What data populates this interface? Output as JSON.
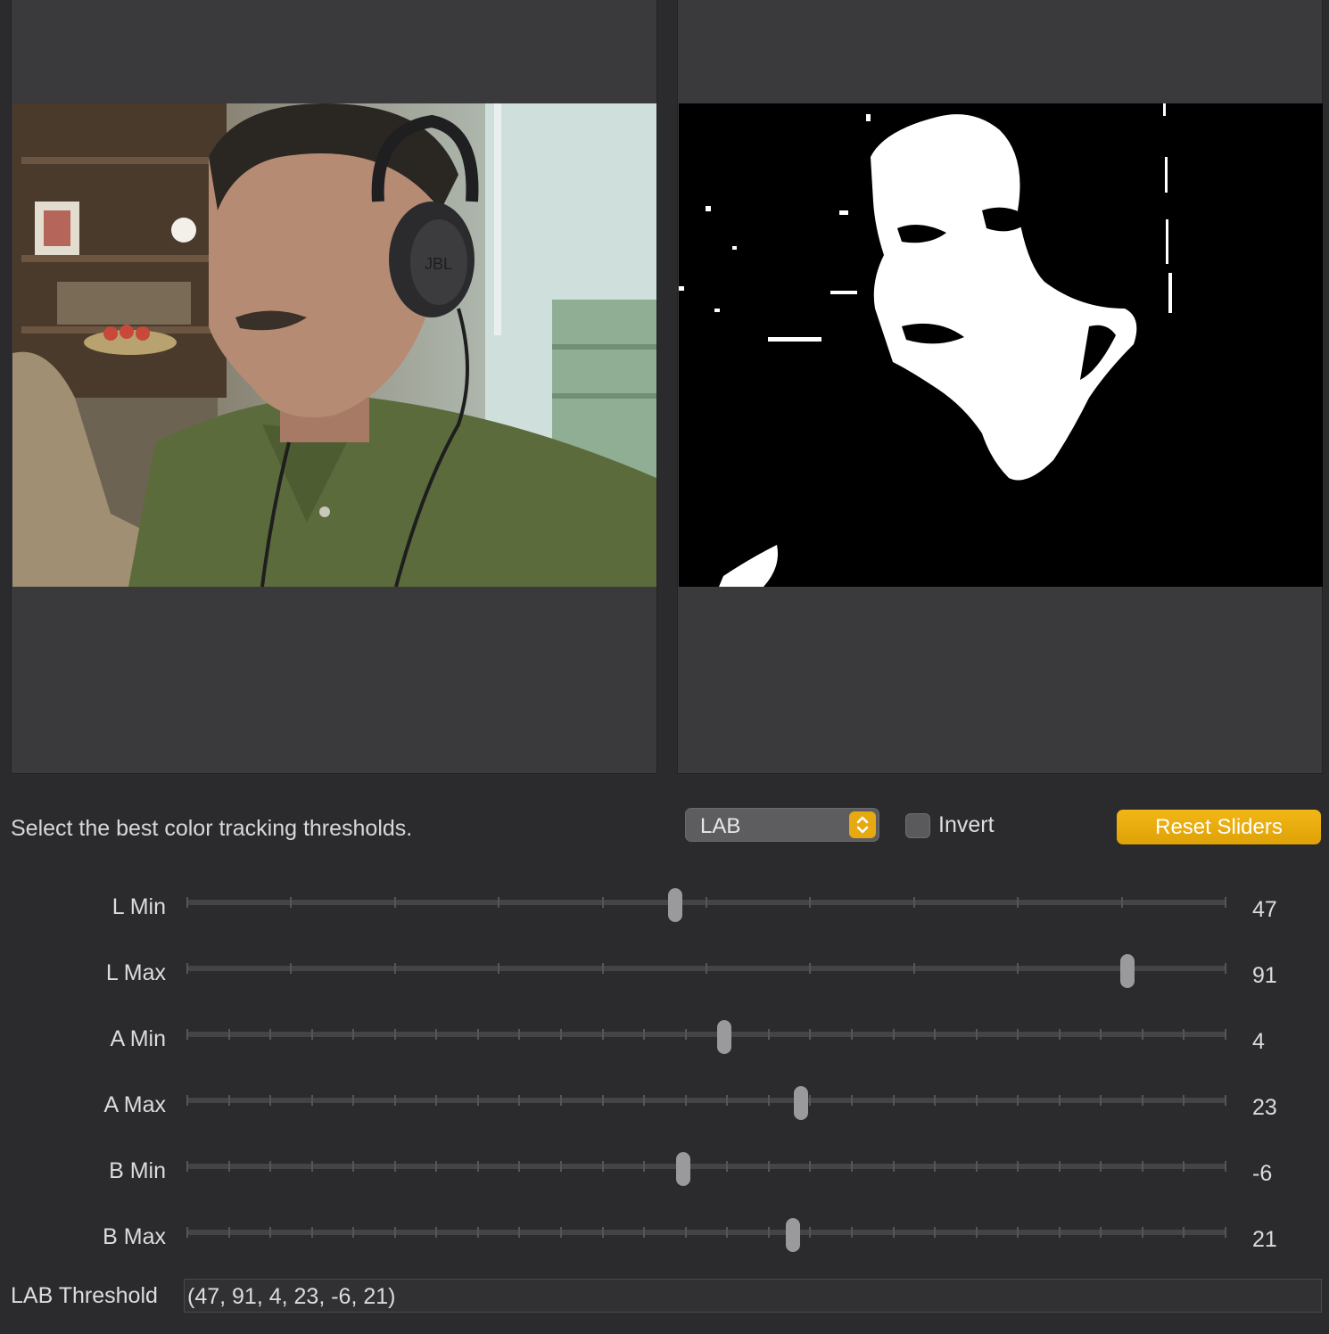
{
  "instruction": "Select the best color tracking thresholds.",
  "colorspace": {
    "selected": "LAB"
  },
  "invert": {
    "label": "Invert",
    "checked": false
  },
  "reset_label": "Reset Sliders",
  "sliders": [
    {
      "label": "L Min",
      "value": "47",
      "fraction": 0.47
    },
    {
      "label": "L Max",
      "value": "91",
      "fraction": 0.905
    },
    {
      "label": "A Min",
      "value": "4",
      "fraction": 0.517
    },
    {
      "label": "A Max",
      "value": "23",
      "fraction": 0.591
    },
    {
      "label": "B Min",
      "value": "-6",
      "fraction": 0.478
    },
    {
      "label": "B Max",
      "value": "21",
      "fraction": 0.583
    }
  ],
  "threshold": {
    "label": "LAB Threshold",
    "value": "(47, 91, 4, 23, -6, 21)"
  },
  "preview": {
    "left_logo_text": "JBL"
  },
  "colors": {
    "accent": "#e6a910",
    "background": "#2b2b2d",
    "panel": "#3a3a3c"
  }
}
